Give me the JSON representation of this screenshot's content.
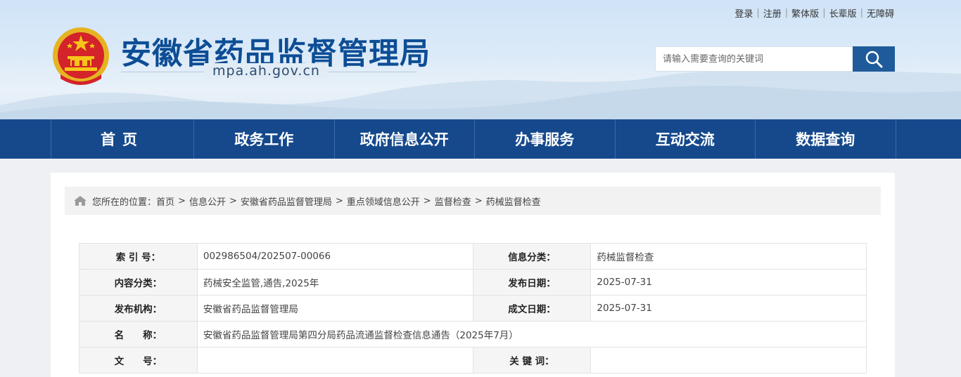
{
  "toplinks": [
    "登录",
    "注册",
    "繁体版",
    "长辈版",
    "无障碍"
  ],
  "site": {
    "title": "安徽省药品监督管理局",
    "url": "mpa.ah.gov.cn"
  },
  "search": {
    "placeholder": "请输入需要查询的关键词"
  },
  "nav": [
    "首页",
    "政务工作",
    "政府信息公开",
    "办事服务",
    "互动交流",
    "数据查询"
  ],
  "breadcrumb": {
    "prefix": "您所在的位置：",
    "items": [
      "首页",
      "信息公开",
      "安徽省药品监督管理局",
      "重点领域信息公开",
      "监督检查",
      "药械监督检查"
    ],
    "separator": ">"
  },
  "meta": {
    "index_label": "索 引 号：",
    "index_value": "002986504/202507-00066",
    "category_label": "信息分类：",
    "category_value": "药械监督检查",
    "content_label": "内容分类：",
    "content_value": "药械安全监管,通告,2025年",
    "pubdate_label": "发布日期：",
    "pubdate_value": "2025-07-31",
    "org_label": "发布机构：",
    "org_value": "安徽省药品监督管理局",
    "docdate_label": "成文日期：",
    "docdate_value": "2025-07-31",
    "name_label": "名　　称：",
    "name_value": "安徽省药品监督管理局第四分局药品流通监督检查信息通告（2025年7月）",
    "docno_label": "文　　号：",
    "docno_value": "",
    "keyword_label": "关 键 词：",
    "keyword_value": ""
  },
  "colors": {
    "nav_bg": "#15498c",
    "title": "#0d4d95",
    "search_btn": "#1f5b9b"
  }
}
